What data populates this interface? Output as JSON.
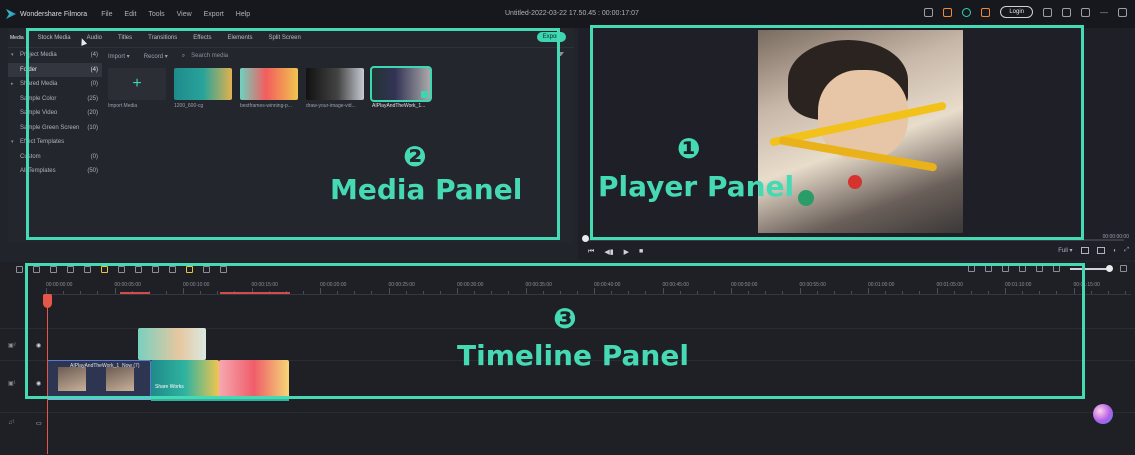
{
  "titlebar": {
    "app_name": "Wondershare Filmora",
    "menu": [
      "File",
      "Edit",
      "Tools",
      "View",
      "Export",
      "Help"
    ],
    "doc_title": "Untitled-2022-03-22 17.50.45 : 00:00:17:07",
    "login": "Login"
  },
  "media_panel": {
    "tabs": [
      "Media",
      "Stock Media",
      "Audio",
      "Titles",
      "Transitions",
      "Effects",
      "Elements",
      "Split Screen"
    ],
    "export": "Export",
    "sidebar": [
      {
        "label": "Project Media",
        "count": "(4)"
      },
      {
        "label": "Folder",
        "count": "(4)"
      },
      {
        "label": "Shared Media",
        "count": "(0)"
      },
      {
        "label": "Sample Color",
        "count": "(25)"
      },
      {
        "label": "Sample Video",
        "count": "(20)"
      },
      {
        "label": "Sample Green Screen",
        "count": "(10)"
      },
      {
        "label": "Effect Templates",
        "count": ""
      },
      {
        "label": "Custom",
        "count": "(0)"
      },
      {
        "label": "All Templates",
        "count": "(50)"
      }
    ],
    "toolbar": {
      "import": "Import",
      "record": "Record",
      "search_placeholder": "Search media"
    },
    "thumbs": [
      {
        "caption": "Import Media"
      },
      {
        "caption": "1200_600-cg"
      },
      {
        "caption": "bestframes-winning-p..."
      },
      {
        "caption": "draw-your-image-vid..."
      },
      {
        "caption": "AIPlayAndTheWork_1..."
      }
    ]
  },
  "player": {
    "time": "00:00:00:00",
    "quality": "Full"
  },
  "timeline": {
    "ruler_labels": [
      "00:00:00:00",
      "00:00:05:00",
      "00:00:10:00",
      "00:00:15:00",
      "00:00:20:00",
      "00:00:25:00",
      "00:00:30:00",
      "00:00:35:00",
      "00:00:40:00",
      "00:00:45:00",
      "00:00:50:00",
      "00:00:55:00",
      "00:01:00:00",
      "00:01:05:00",
      "00:01:10:00",
      "00:01:15:00"
    ],
    "clip_b_label": "AIPlayAndTheWork_1",
    "clip_b_label2": "Now (7)",
    "clip_c_label": "Share Works"
  },
  "annotations": {
    "media": {
      "num": "❷",
      "label": "Media Panel"
    },
    "player": {
      "num": "❶",
      "label": "Player Panel"
    },
    "timeline": {
      "num": "❸",
      "label": "Timeline Panel"
    },
    "color": "#45d9b4"
  }
}
